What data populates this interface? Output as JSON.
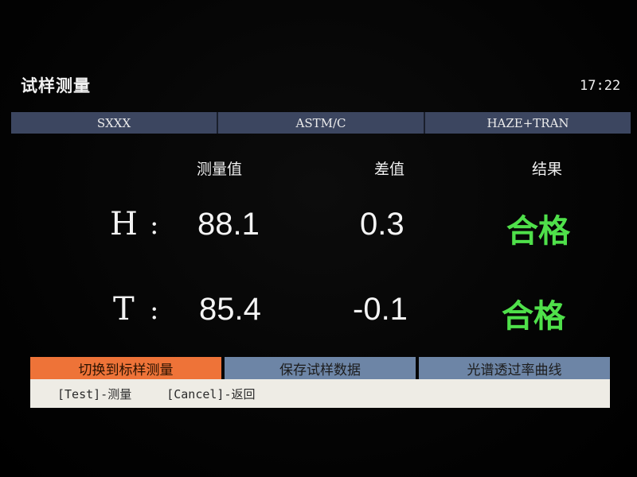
{
  "header": {
    "title": "试样测量",
    "time": "17:22"
  },
  "info_bar": {
    "sample": "SXXX",
    "standard": "ASTM/C",
    "mode": "HAZE+TRAN"
  },
  "table": {
    "columns": [
      "测量值",
      "差值",
      "结果"
    ],
    "rows": [
      {
        "label": "H",
        "separator": ":",
        "measured": "88.1",
        "difference": "0.3",
        "result": "合格"
      },
      {
        "label": "T",
        "separator": ":",
        "measured": "85.4",
        "difference": "-0.1",
        "result": "合格"
      }
    ]
  },
  "buttons": [
    {
      "label": "切换到标样测量",
      "active": true
    },
    {
      "label": "保存试样数据",
      "active": false
    },
    {
      "label": "光谱透过率曲线",
      "active": false
    }
  ],
  "hints": [
    "[Test]-测量",
    "[Cancel]-返回"
  ],
  "colors": {
    "pass_green": "#4fe04a",
    "active_button": "#ee7338",
    "button": "#6d85a6",
    "info_bar": "#3c4660",
    "hint_bar": "#eeece5"
  }
}
